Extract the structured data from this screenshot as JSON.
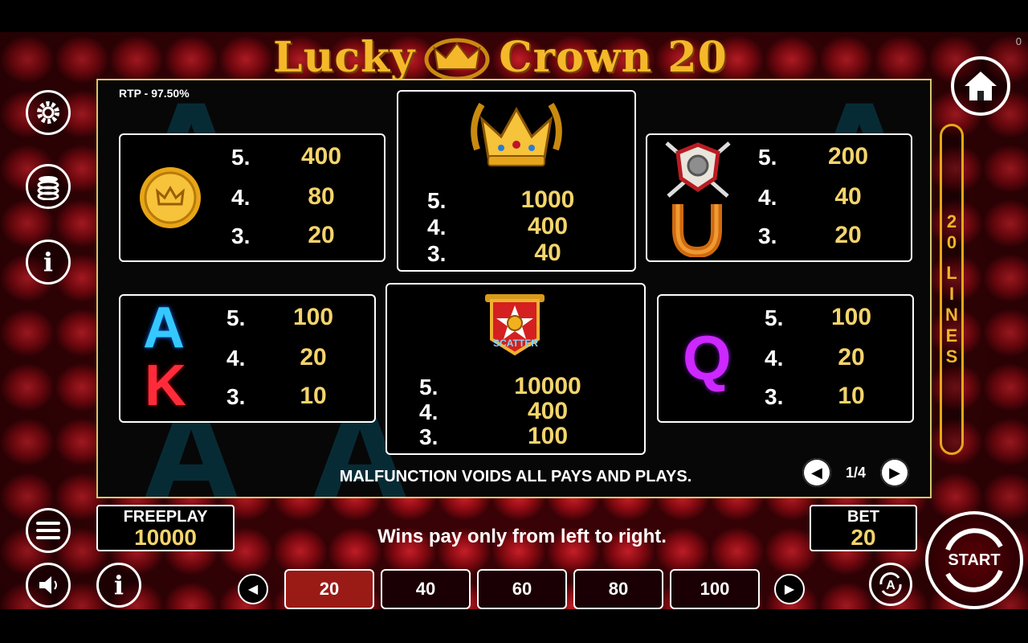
{
  "header": {
    "title_part1": "Lucky",
    "title_part2": "Crown 20",
    "counter": "0"
  },
  "paytable": {
    "rtp": "RTP - 97.50%",
    "cards": [
      {
        "symbol": "coin",
        "rows": [
          {
            "n": "5.",
            "v": "400"
          },
          {
            "n": "4.",
            "v": "80"
          },
          {
            "n": "3.",
            "v": "20"
          }
        ]
      },
      {
        "symbol": "crown",
        "rows": [
          {
            "n": "5.",
            "v": "1000"
          },
          {
            "n": "4.",
            "v": "400"
          },
          {
            "n": "3.",
            "v": "40"
          }
        ]
      },
      {
        "symbol": "shield-horseshoe",
        "rows": [
          {
            "n": "5.",
            "v": "200"
          },
          {
            "n": "4.",
            "v": "40"
          },
          {
            "n": "3.",
            "v": "20"
          }
        ]
      },
      {
        "symbol": "ace-king",
        "glyph_a": "A",
        "glyph_k": "K",
        "rows": [
          {
            "n": "5.",
            "v": "100"
          },
          {
            "n": "4.",
            "v": "20"
          },
          {
            "n": "3.",
            "v": "10"
          }
        ]
      },
      {
        "symbol": "scatter",
        "scatter_label": "SCATTER",
        "rows": [
          {
            "n": "5.",
            "v": "10000"
          },
          {
            "n": "4.",
            "v": "400"
          },
          {
            "n": "3.",
            "v": "100"
          }
        ]
      },
      {
        "symbol": "queen",
        "glyph_q": "Q",
        "rows": [
          {
            "n": "5.",
            "v": "100"
          },
          {
            "n": "4.",
            "v": "20"
          },
          {
            "n": "3.",
            "v": "10"
          }
        ]
      }
    ],
    "disclaimer": "MALFUNCTION VOIDS ALL PAYS AND PLAYS.",
    "page_indicator": "1/4"
  },
  "lines_label": [
    "2",
    "0",
    "",
    "L",
    "I",
    "N",
    "E",
    "S"
  ],
  "freeplay": {
    "label": "FREEPLAY",
    "value": "10000"
  },
  "bet": {
    "label": "BET",
    "value": "20"
  },
  "message": "Wins pay only from left to right.",
  "bet_options": [
    "20",
    "40",
    "60",
    "80",
    "100"
  ],
  "selected_bet_index": 0,
  "start_label": "START",
  "colors": {
    "gold": "#f4d46b",
    "frame": "#d9c56e",
    "selected": "#9a1b16",
    "lines": "#e7a61b"
  }
}
